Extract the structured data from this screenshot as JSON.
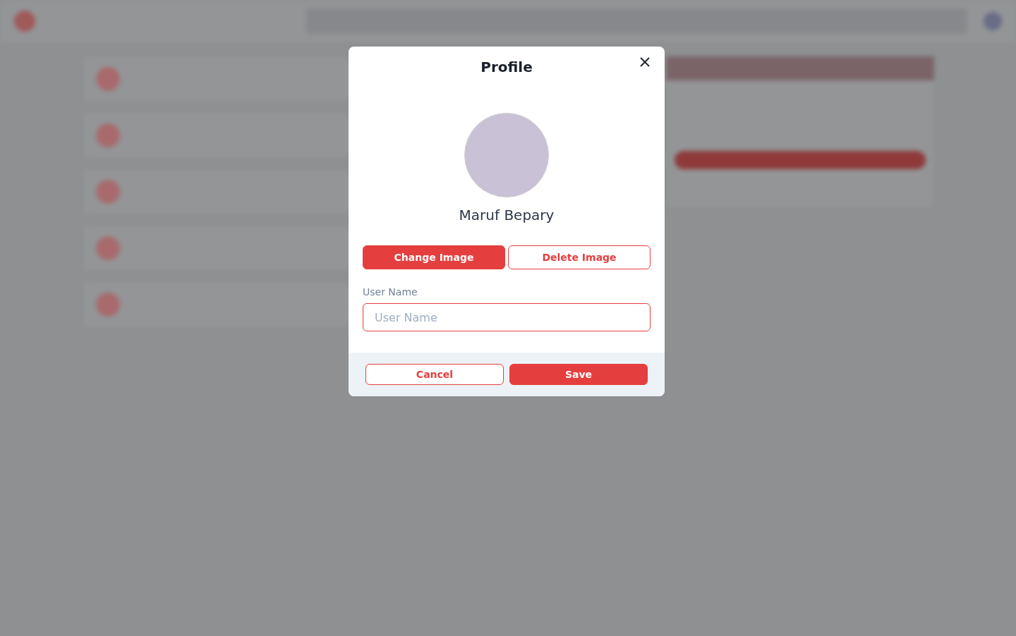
{
  "dialog": {
    "title": "Profile",
    "user_name": "Maruf Bepary",
    "image_buttons": [
      {
        "label": "Change Image",
        "kind": "primary"
      },
      {
        "label": "Delete Image",
        "kind": "outline"
      }
    ],
    "field": {
      "label": "User Name",
      "placeholder": "User Name"
    },
    "footer_buttons": [
      {
        "label": "Cancel",
        "kind": "outline"
      },
      {
        "label": "Save",
        "kind": "primary"
      }
    ]
  }
}
